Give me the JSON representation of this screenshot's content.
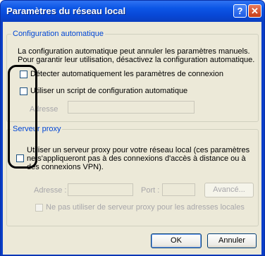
{
  "window": {
    "title": "Paramètres du réseau local"
  },
  "titlebar": {
    "help_glyph": "?",
    "close_glyph": "✕"
  },
  "auto_config": {
    "group_label": "Configuration automatique",
    "description": "La configuration automatique peut annuler les paramètres manuels. Pour garantir leur utilisation, désactivez la configuration automatique.",
    "detect_label": "Détecter automatiquement les paramètres de connexion",
    "detect_checked": false,
    "script_label": "Utiliser un script de configuration automatique",
    "script_checked": false,
    "address_label": "Adresse",
    "address_value": ""
  },
  "proxy": {
    "group_label": "Serveur proxy",
    "use_proxy_label": "Utiliser un serveur proxy pour votre réseau local (ces paramètres ne s'appliqueront pas à des connexions d'accès à distance ou à des connexions VPN).",
    "use_proxy_checked": false,
    "address_label": "Adresse :",
    "address_value": "",
    "port_label": "Port :",
    "port_value": "",
    "advanced_label": "Avancé...",
    "bypass_label": "Ne pas utiliser de serveur proxy pour les adresses locales",
    "bypass_checked": false
  },
  "footer": {
    "ok_label": "OK",
    "cancel_label": "Annuler"
  },
  "colors": {
    "titlebar": "#0a3ec8",
    "dialog_bg": "#ece9d8",
    "group_label": "#0046d5",
    "annotation": "#000000"
  }
}
